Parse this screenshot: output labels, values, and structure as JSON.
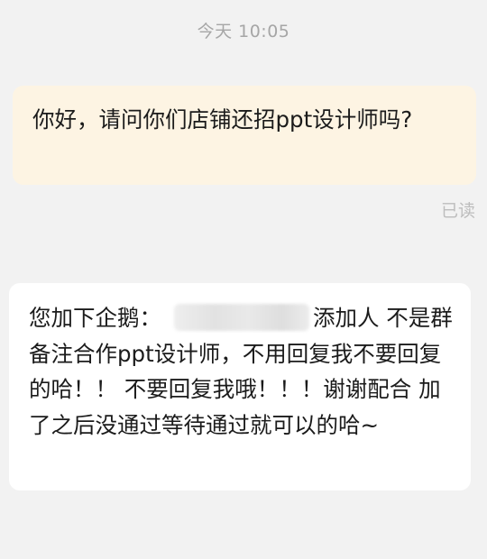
{
  "chat": {
    "timestamp": "今天  10:05",
    "outgoing": {
      "text": "你好，请问你们店铺还招ppt设计师吗?",
      "status": "已读"
    },
    "incoming": {
      "text_before_redaction": "您加下企鹅：",
      "text_after_redaction": "添加人  不是群 备注合作ppt设计师，不用回复我不要回复的哈！！ 不要回复我哦！！！谢谢配合 加了之后没通过等待通过就可以的哈~"
    }
  }
}
